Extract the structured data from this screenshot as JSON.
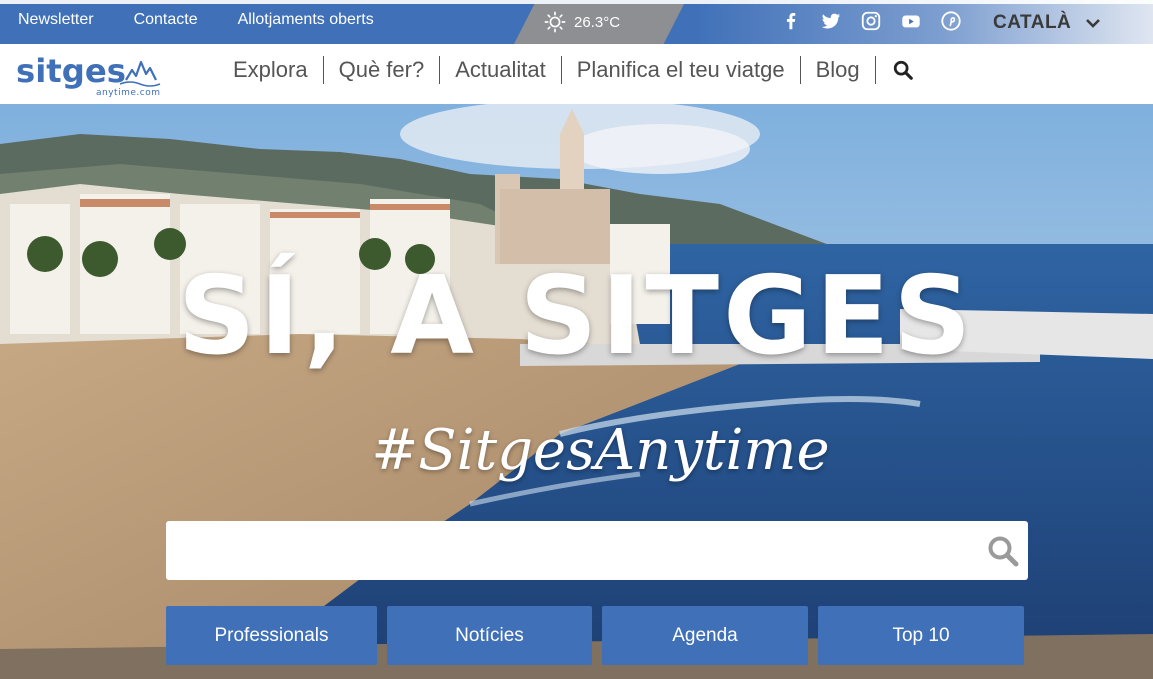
{
  "topbar": {
    "links": [
      "Newsletter",
      "Contacte",
      "Allotjaments oberts"
    ],
    "weather": {
      "icon": "sun-icon",
      "temperature": "26.3°C"
    },
    "social": [
      "facebook-icon",
      "twitter-icon",
      "instagram-icon",
      "youtube-icon",
      "pinterest-icon"
    ],
    "language": "CATALÀ"
  },
  "nav": {
    "logo": {
      "main": "sitges",
      "sub": "anytime.com"
    },
    "items": [
      "Explora",
      "Què fer?",
      "Actualitat",
      "Planifica el teu viatge",
      "Blog"
    ]
  },
  "hero": {
    "title": "SÍ, A SITGES",
    "hashtag": "#SitgesAnytime",
    "search_placeholder": "",
    "buttons": [
      "Professionals",
      "Notícies",
      "Agenda",
      "Top 10"
    ]
  },
  "colors": {
    "brand_blue": "#3f70b8",
    "weather_gray": "#8d8f93",
    "nav_text": "#555555"
  }
}
